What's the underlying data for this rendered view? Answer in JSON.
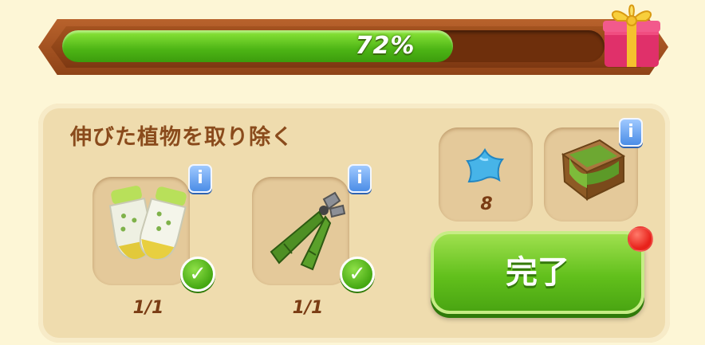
{
  "progress": {
    "percent_label": "72%",
    "fraction": 0.72
  },
  "task": {
    "title": "伸びた植物を取り除く"
  },
  "items": [
    {
      "icon": "gloves-icon",
      "count": "1/1",
      "complete": true
    },
    {
      "icon": "pruning-shears-icon",
      "count": "1/1",
      "complete": true
    }
  ],
  "rewards": [
    {
      "icon": "blue-star-icon",
      "amount": "8"
    },
    {
      "icon": "planter-box-icon"
    }
  ],
  "action": {
    "done_label": "完了"
  },
  "info_label": "i",
  "colors": {
    "accent_green": "#62c01c",
    "bar_frame": "#b8622c",
    "info_blue": "#4b8de6"
  }
}
